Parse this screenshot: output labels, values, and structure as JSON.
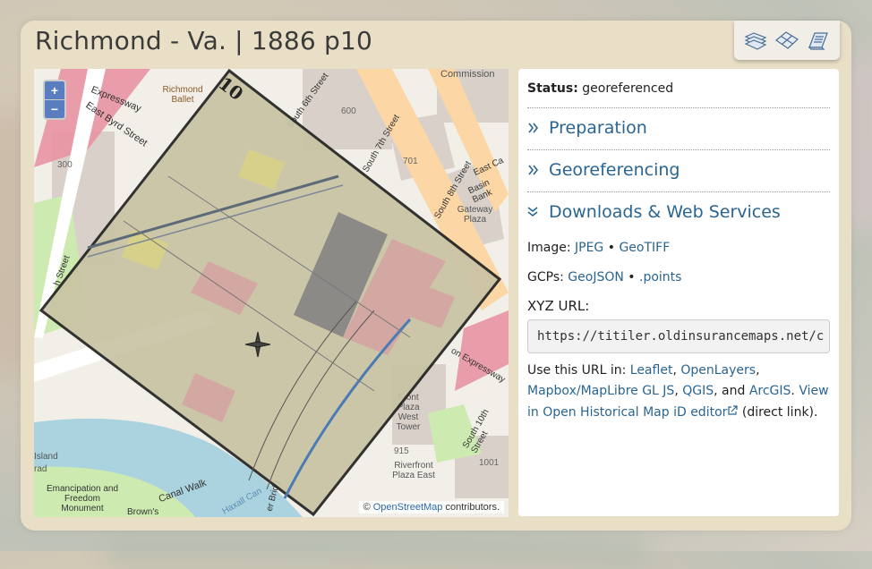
{
  "title": "Richmond - Va. | 1886 p10",
  "toolbar": {
    "icons": [
      "map-stack-icon",
      "map-grid-icon",
      "book-icon"
    ]
  },
  "map": {
    "zoom_in": "+",
    "zoom_out": "−",
    "attribution_prefix": "©",
    "attribution_link": "OpenStreetMap",
    "attribution_suffix": "contributors.",
    "sheet_number": "10",
    "labels": {
      "expressway": "Expressway",
      "east_byrd": "East Byrd Street",
      "south_6th": "South 6th Street",
      "south_7th": "South 7th Street",
      "south_8th": "South 8th Street",
      "south_10th": "South 10th Street",
      "street_left": "h Street",
      "commission": "Commission",
      "richmond_ballet": "Richmond Ballet",
      "n600": "600",
      "n701": "701",
      "n300": "300",
      "basin_bank": "Basin Bank",
      "gateway_plaza": "Gateway Plaza",
      "riverfront_west": "Front Plaza West Tower",
      "n915": "915",
      "riverfront_east": "Riverfront Plaza East",
      "n1001": "1001",
      "emancipation": "Emancipation and Freedom Monument",
      "canal_walk": "Canal Walk",
      "browns": "Brown's",
      "bridge": "er Bridg",
      "n_expressway": "on Expressway",
      "east_ca": "East Ca",
      "haxall": "Haxall Can",
      "island": "Island",
      "rad": "rad"
    }
  },
  "sidebar": {
    "status_label": "Status:",
    "status_value": "georeferenced",
    "sections": [
      {
        "label": "Preparation",
        "state": "collapsed"
      },
      {
        "label": "Georeferencing",
        "state": "collapsed"
      },
      {
        "label": "Downloads & Web Services",
        "state": "expanded"
      }
    ],
    "image_label": "Image:",
    "image_jpeg": "JPEG",
    "bullet": "•",
    "image_geotiff": "GeoTIFF",
    "gcps_label": "GCPs:",
    "gcps_geojson": "GeoJSON",
    "gcps_points": ".points",
    "xyz_label": "XYZ URL:",
    "xyz_url": "https://titiler.oldinsurancemaps.net/c",
    "use_prefix": "Use this URL in:",
    "use_leaflet": "Leaflet",
    "use_comma1": ",",
    "use_openlayers": "OpenLayers",
    "use_comma2": ",",
    "use_mapbox": "Mapbox/MapLibre GL JS",
    "use_comma3": ",",
    "use_qgis": "QGIS",
    "use_and": ", and",
    "use_arcgis": "ArcGIS",
    "use_period": ".",
    "view_link": "View in Open Historical Map iD editor",
    "view_suffix": "(direct link)."
  },
  "colors": {
    "panel": "#e9dfc6",
    "link": "#2a6592",
    "zoom": "#5a7dc0"
  }
}
